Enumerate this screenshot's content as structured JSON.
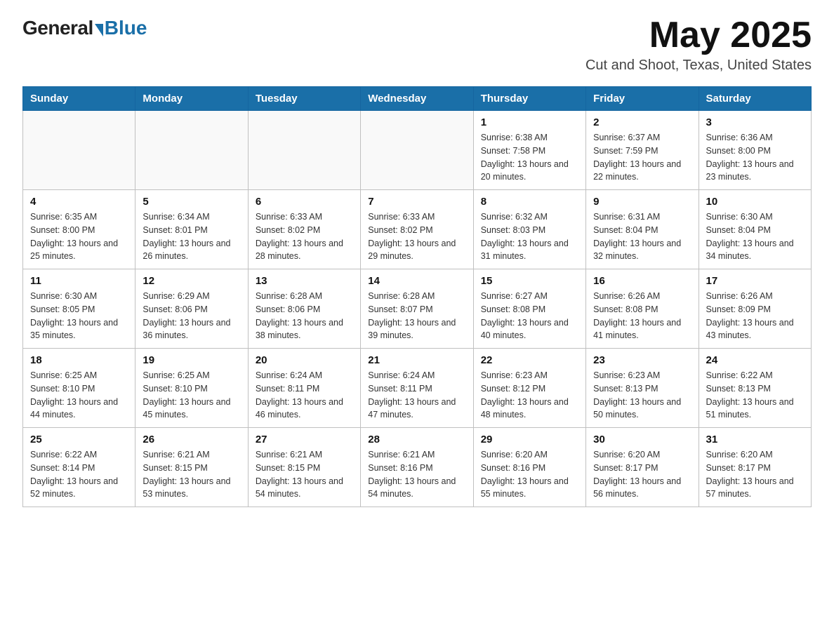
{
  "logo": {
    "general": "General",
    "blue": "Blue",
    "subtitle": ""
  },
  "header": {
    "month": "May 2025",
    "location": "Cut and Shoot, Texas, United States"
  },
  "weekdays": [
    "Sunday",
    "Monday",
    "Tuesday",
    "Wednesday",
    "Thursday",
    "Friday",
    "Saturday"
  ],
  "weeks": [
    [
      {
        "day": "",
        "sunrise": "",
        "sunset": "",
        "daylight": ""
      },
      {
        "day": "",
        "sunrise": "",
        "sunset": "",
        "daylight": ""
      },
      {
        "day": "",
        "sunrise": "",
        "sunset": "",
        "daylight": ""
      },
      {
        "day": "",
        "sunrise": "",
        "sunset": "",
        "daylight": ""
      },
      {
        "day": "1",
        "sunrise": "Sunrise: 6:38 AM",
        "sunset": "Sunset: 7:58 PM",
        "daylight": "Daylight: 13 hours and 20 minutes."
      },
      {
        "day": "2",
        "sunrise": "Sunrise: 6:37 AM",
        "sunset": "Sunset: 7:59 PM",
        "daylight": "Daylight: 13 hours and 22 minutes."
      },
      {
        "day": "3",
        "sunrise": "Sunrise: 6:36 AM",
        "sunset": "Sunset: 8:00 PM",
        "daylight": "Daylight: 13 hours and 23 minutes."
      }
    ],
    [
      {
        "day": "4",
        "sunrise": "Sunrise: 6:35 AM",
        "sunset": "Sunset: 8:00 PM",
        "daylight": "Daylight: 13 hours and 25 minutes."
      },
      {
        "day": "5",
        "sunrise": "Sunrise: 6:34 AM",
        "sunset": "Sunset: 8:01 PM",
        "daylight": "Daylight: 13 hours and 26 minutes."
      },
      {
        "day": "6",
        "sunrise": "Sunrise: 6:33 AM",
        "sunset": "Sunset: 8:02 PM",
        "daylight": "Daylight: 13 hours and 28 minutes."
      },
      {
        "day": "7",
        "sunrise": "Sunrise: 6:33 AM",
        "sunset": "Sunset: 8:02 PM",
        "daylight": "Daylight: 13 hours and 29 minutes."
      },
      {
        "day": "8",
        "sunrise": "Sunrise: 6:32 AM",
        "sunset": "Sunset: 8:03 PM",
        "daylight": "Daylight: 13 hours and 31 minutes."
      },
      {
        "day": "9",
        "sunrise": "Sunrise: 6:31 AM",
        "sunset": "Sunset: 8:04 PM",
        "daylight": "Daylight: 13 hours and 32 minutes."
      },
      {
        "day": "10",
        "sunrise": "Sunrise: 6:30 AM",
        "sunset": "Sunset: 8:04 PM",
        "daylight": "Daylight: 13 hours and 34 minutes."
      }
    ],
    [
      {
        "day": "11",
        "sunrise": "Sunrise: 6:30 AM",
        "sunset": "Sunset: 8:05 PM",
        "daylight": "Daylight: 13 hours and 35 minutes."
      },
      {
        "day": "12",
        "sunrise": "Sunrise: 6:29 AM",
        "sunset": "Sunset: 8:06 PM",
        "daylight": "Daylight: 13 hours and 36 minutes."
      },
      {
        "day": "13",
        "sunrise": "Sunrise: 6:28 AM",
        "sunset": "Sunset: 8:06 PM",
        "daylight": "Daylight: 13 hours and 38 minutes."
      },
      {
        "day": "14",
        "sunrise": "Sunrise: 6:28 AM",
        "sunset": "Sunset: 8:07 PM",
        "daylight": "Daylight: 13 hours and 39 minutes."
      },
      {
        "day": "15",
        "sunrise": "Sunrise: 6:27 AM",
        "sunset": "Sunset: 8:08 PM",
        "daylight": "Daylight: 13 hours and 40 minutes."
      },
      {
        "day": "16",
        "sunrise": "Sunrise: 6:26 AM",
        "sunset": "Sunset: 8:08 PM",
        "daylight": "Daylight: 13 hours and 41 minutes."
      },
      {
        "day": "17",
        "sunrise": "Sunrise: 6:26 AM",
        "sunset": "Sunset: 8:09 PM",
        "daylight": "Daylight: 13 hours and 43 minutes."
      }
    ],
    [
      {
        "day": "18",
        "sunrise": "Sunrise: 6:25 AM",
        "sunset": "Sunset: 8:10 PM",
        "daylight": "Daylight: 13 hours and 44 minutes."
      },
      {
        "day": "19",
        "sunrise": "Sunrise: 6:25 AM",
        "sunset": "Sunset: 8:10 PM",
        "daylight": "Daylight: 13 hours and 45 minutes."
      },
      {
        "day": "20",
        "sunrise": "Sunrise: 6:24 AM",
        "sunset": "Sunset: 8:11 PM",
        "daylight": "Daylight: 13 hours and 46 minutes."
      },
      {
        "day": "21",
        "sunrise": "Sunrise: 6:24 AM",
        "sunset": "Sunset: 8:11 PM",
        "daylight": "Daylight: 13 hours and 47 minutes."
      },
      {
        "day": "22",
        "sunrise": "Sunrise: 6:23 AM",
        "sunset": "Sunset: 8:12 PM",
        "daylight": "Daylight: 13 hours and 48 minutes."
      },
      {
        "day": "23",
        "sunrise": "Sunrise: 6:23 AM",
        "sunset": "Sunset: 8:13 PM",
        "daylight": "Daylight: 13 hours and 50 minutes."
      },
      {
        "day": "24",
        "sunrise": "Sunrise: 6:22 AM",
        "sunset": "Sunset: 8:13 PM",
        "daylight": "Daylight: 13 hours and 51 minutes."
      }
    ],
    [
      {
        "day": "25",
        "sunrise": "Sunrise: 6:22 AM",
        "sunset": "Sunset: 8:14 PM",
        "daylight": "Daylight: 13 hours and 52 minutes."
      },
      {
        "day": "26",
        "sunrise": "Sunrise: 6:21 AM",
        "sunset": "Sunset: 8:15 PM",
        "daylight": "Daylight: 13 hours and 53 minutes."
      },
      {
        "day": "27",
        "sunrise": "Sunrise: 6:21 AM",
        "sunset": "Sunset: 8:15 PM",
        "daylight": "Daylight: 13 hours and 54 minutes."
      },
      {
        "day": "28",
        "sunrise": "Sunrise: 6:21 AM",
        "sunset": "Sunset: 8:16 PM",
        "daylight": "Daylight: 13 hours and 54 minutes."
      },
      {
        "day": "29",
        "sunrise": "Sunrise: 6:20 AM",
        "sunset": "Sunset: 8:16 PM",
        "daylight": "Daylight: 13 hours and 55 minutes."
      },
      {
        "day": "30",
        "sunrise": "Sunrise: 6:20 AM",
        "sunset": "Sunset: 8:17 PM",
        "daylight": "Daylight: 13 hours and 56 minutes."
      },
      {
        "day": "31",
        "sunrise": "Sunrise: 6:20 AM",
        "sunset": "Sunset: 8:17 PM",
        "daylight": "Daylight: 13 hours and 57 minutes."
      }
    ]
  ]
}
